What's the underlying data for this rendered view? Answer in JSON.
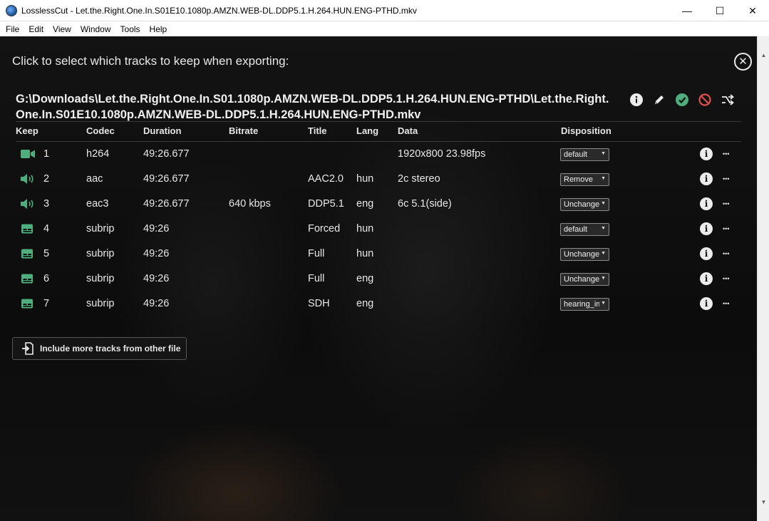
{
  "window": {
    "title": "LosslessCut - Let.the.Right.One.In.S01E10.1080p.AMZN.WEB-DL.DDP5.1.H.264.HUN.ENG-PTHD.mkv",
    "minimize": "—",
    "maximize": "☐",
    "close": "✕"
  },
  "menu": [
    "File",
    "Edit",
    "View",
    "Window",
    "Tools",
    "Help"
  ],
  "dialog": {
    "heading": "Click to select which tracks to keep when exporting:",
    "close_glyph": "✕",
    "file_path": "G:\\Downloads\\Let.the.Right.One.In.S01.1080p.AMZN.WEB-DL.DDP5.1.H.264.HUN.ENG-PTHD\\Let.the.Right.One.In.S01E10.1080p.AMZN.WEB-DL.DDP5.1.H.264.HUN.ENG-PTHD.mkv",
    "file_actions": [
      "info-icon",
      "edit-pencil-icon",
      "check-circle-icon",
      "ban-icon",
      "shuffle-icon"
    ],
    "columns": [
      "Keep",
      "Codec",
      "Duration",
      "Bitrate",
      "Title",
      "Lang",
      "Data",
      "Disposition"
    ],
    "tracks": [
      {
        "type": "video",
        "icon": "video-camera-icon",
        "num": "1",
        "codec": "h264",
        "duration": "49:26.677",
        "bitrate": "",
        "title": "",
        "lang": "",
        "data": "1920x800 23.98fps",
        "disposition": "default"
      },
      {
        "type": "audio",
        "icon": "speaker-icon",
        "num": "2",
        "codec": "aac",
        "duration": "49:26.677",
        "bitrate": "",
        "title": "AAC2.0",
        "lang": "hun",
        "data": "2c stereo",
        "disposition": "Remove"
      },
      {
        "type": "audio",
        "icon": "speaker-icon",
        "num": "3",
        "codec": "eac3",
        "duration": "49:26.677",
        "bitrate": "640 kbps",
        "title": "DDP5.1",
        "lang": "eng",
        "data": "6c 5.1(side)",
        "disposition": "Unchanged"
      },
      {
        "type": "subtitle",
        "icon": "subtitles-icon",
        "num": "4",
        "codec": "subrip",
        "duration": "49:26",
        "bitrate": "",
        "title": "Forced",
        "lang": "hun",
        "data": "",
        "disposition": "default"
      },
      {
        "type": "subtitle",
        "icon": "subtitles-icon",
        "num": "5",
        "codec": "subrip",
        "duration": "49:26",
        "bitrate": "",
        "title": "Full",
        "lang": "hun",
        "data": "",
        "disposition": "Unchanged"
      },
      {
        "type": "subtitle",
        "icon": "subtitles-icon",
        "num": "6",
        "codec": "subrip",
        "duration": "49:26",
        "bitrate": "",
        "title": "Full",
        "lang": "eng",
        "data": "",
        "disposition": "Unchanged"
      },
      {
        "type": "subtitle",
        "icon": "subtitles-icon",
        "num": "7",
        "codec": "subrip",
        "duration": "49:26",
        "bitrate": "",
        "title": "SDH",
        "lang": "eng",
        "data": "",
        "disposition": "hearing_impaired"
      }
    ],
    "include_button": "Include more tracks from other file",
    "colors": {
      "accent_green": "#4fae7d",
      "ban_red": "#e05050",
      "background": "#0e0e0e"
    }
  }
}
